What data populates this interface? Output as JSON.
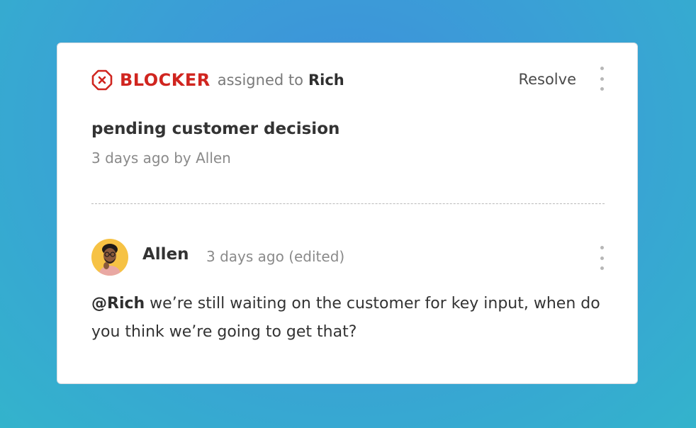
{
  "blocker": {
    "icon": "blocker-x-octagon-icon",
    "label": "BLOCKER",
    "assigned_text": "assigned to",
    "assignee": "Rich",
    "color": "#d0251f"
  },
  "actions": {
    "resolve_label": "Resolve",
    "menu_icon": "more-vertical-icon"
  },
  "issue": {
    "title": "pending customer decision",
    "meta": "3 days ago by Allen"
  },
  "comment": {
    "author": "Allen",
    "meta": "3 days ago (edited)",
    "mention": "@Rich",
    "text": " we’re still waiting on the customer for key input, when do you think we’re going to get that?",
    "avatar_icon": "user-avatar",
    "menu_icon": "more-vertical-icon"
  }
}
